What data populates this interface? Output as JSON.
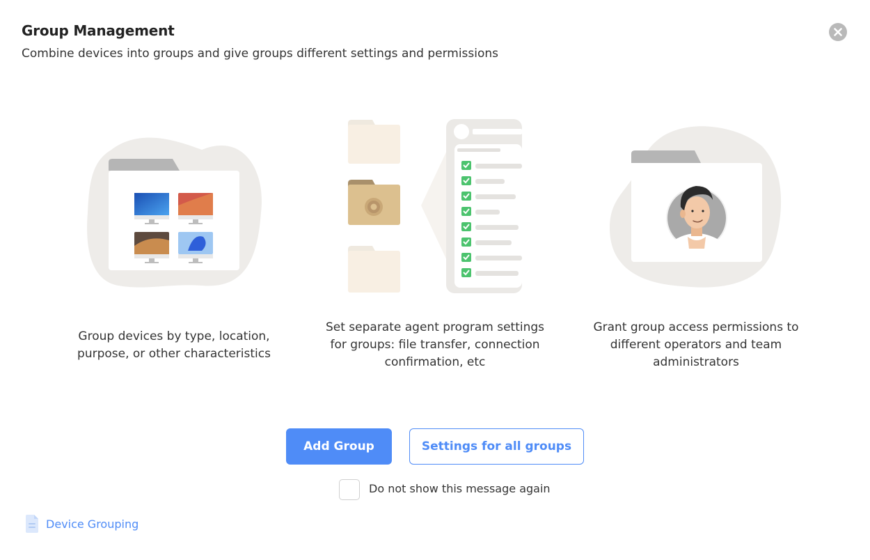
{
  "header": {
    "title": "Group Management",
    "subtitle": "Combine devices into groups and give groups different settings and permissions"
  },
  "features": [
    {
      "line1": "Group devices by type, location,",
      "line2": "purpose, or other characteristics",
      "line3": ""
    },
    {
      "line1": "Set separate agent program settings",
      "line2": "for groups: file transfer, connection",
      "line3": "confirmation, etc"
    },
    {
      "line1": "Grant group access permissions to",
      "line2": "different operators and team",
      "line3": "administrators"
    }
  ],
  "actions": {
    "add_group": "Add Group",
    "settings_all": "Settings for all groups"
  },
  "checkbox": {
    "label": "Do not show this message again",
    "checked": false
  },
  "footer": {
    "doc_link": "Device Grouping"
  },
  "colors": {
    "accent": "#4f8cf7",
    "check_green": "#4cc36e",
    "folder_gold": "#dcc08f",
    "blob_gray": "#eeece9"
  }
}
